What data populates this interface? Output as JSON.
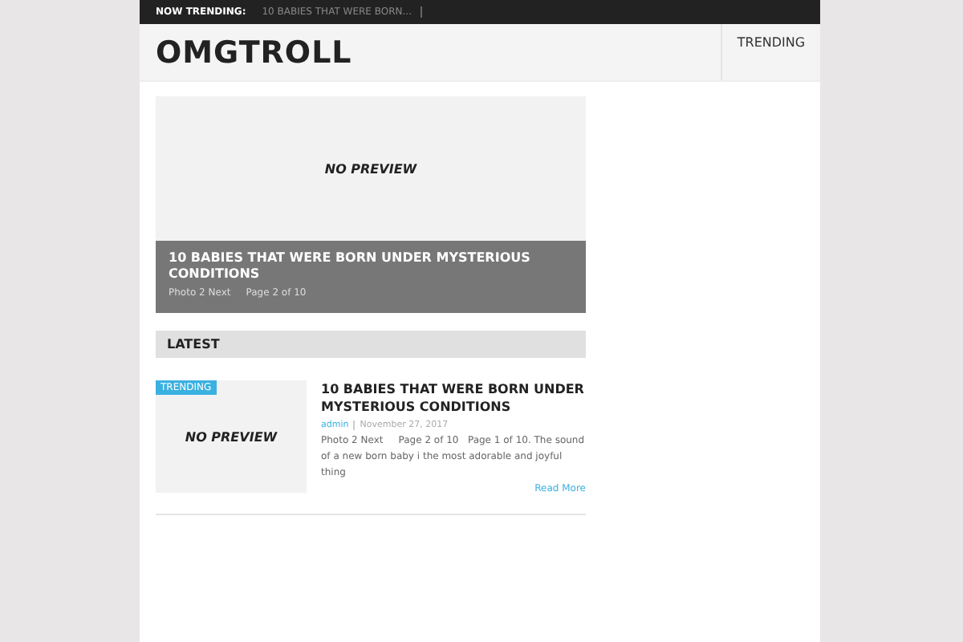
{
  "ticker": {
    "label": "NOW TRENDING:",
    "items": [
      "10 BABIES THAT WERE BORN..."
    ]
  },
  "site": {
    "title": "OMGTROLL",
    "nav": [
      "TRENDING"
    ]
  },
  "featured": {
    "preview": "NO PREVIEW",
    "title": "10 BABIES THAT WERE BORN UNDER MYSTERIOUS CONDITIONS",
    "excerpt": "Photo 2 Next     Page 2 of 10"
  },
  "latest": {
    "heading": "LATEST",
    "posts": [
      {
        "badge": "TRENDING",
        "preview": "NO PREVIEW",
        "title": "10 BABIES THAT WERE BORN UNDER MYSTERIOUS CONDITIONS",
        "author": "admin",
        "date": "November 27, 2017",
        "excerpt": "Photo 2 Next     Page 2 of 10   Page 1 of 10. The sound of a new born baby i the most adorable and joyful thing",
        "more": "Read More"
      }
    ]
  }
}
